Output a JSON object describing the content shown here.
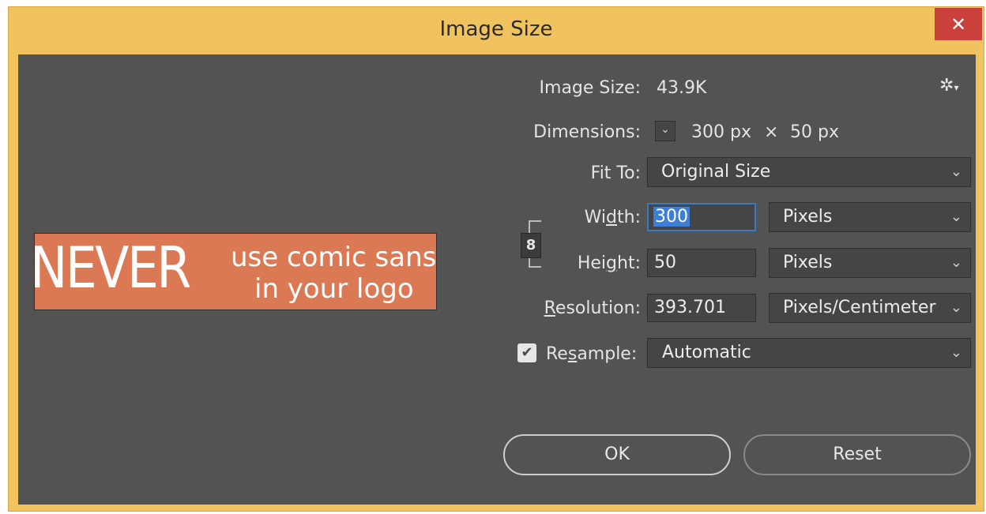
{
  "window": {
    "title": "Image Size",
    "close_glyph": "✕"
  },
  "preview": {
    "big_text": "NEVER",
    "line1": "use comic sans",
    "line2": "in your logo"
  },
  "image_size": {
    "label": "Image Size:",
    "value": "43.9K"
  },
  "gear": {
    "icon": "gear-icon",
    "glyph": "✲",
    "caret": "▾"
  },
  "dimensions": {
    "label": "Dimensions:",
    "width": "300 px",
    "times": "×",
    "height": "50 px",
    "toggle_glyph": "⌄"
  },
  "fit_to": {
    "label": "Fit To:",
    "value": "Original Size"
  },
  "width": {
    "label_pre": "Wi",
    "label_u": "d",
    "label_post": "th:",
    "value": "300",
    "unit": "Pixels"
  },
  "height": {
    "label_pre": "Hei",
    "label_u": "g",
    "label_post": "ht:",
    "value": "50",
    "unit": "Pixels"
  },
  "resolution": {
    "label_u": "R",
    "label_post": "esolution:",
    "value": "393.701",
    "unit": "Pixels/Centimeter"
  },
  "resample": {
    "label_pre": "Re",
    "label_u": "s",
    "label_post": "ample:",
    "value": "Automatic",
    "checked": true,
    "check_glyph": "✔"
  },
  "link": {
    "icon": "chain-link-icon",
    "glyph": "8"
  },
  "chevron": "⌄",
  "buttons": {
    "ok": "OK",
    "reset": "Reset"
  }
}
